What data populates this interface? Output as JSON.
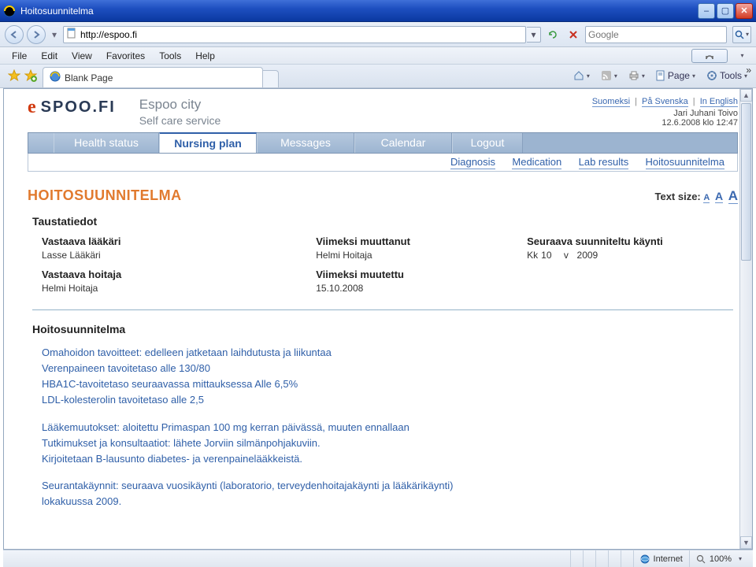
{
  "window": {
    "title": "Hoitosuunnitelma"
  },
  "address_bar": {
    "url": "http://espoo.fi"
  },
  "search": {
    "placeholder": "Google"
  },
  "menus": {
    "file": "File",
    "edit": "Edit",
    "view": "View",
    "favorites": "Favorites",
    "tools": "Tools",
    "help": "Help"
  },
  "tab": {
    "label": "Blank Page"
  },
  "cmdbar": {
    "page": "Page",
    "tools": "Tools"
  },
  "statusbar": {
    "zone": "Internet",
    "zoom": "100%"
  },
  "header": {
    "brand_e": "e",
    "brand_rest": "SPOO.FI",
    "slogan1": "Espoo city",
    "slogan2": "Self care service",
    "lang_fi": "Suomeksi",
    "lang_sv": "På Svenska",
    "lang_en": "In English",
    "user": "Jari Juhani Toivo",
    "datetime": "12.6.2008 klo 12:47"
  },
  "maintabs": {
    "health": "Health status",
    "nursing": "Nursing plan",
    "messages": "Messages",
    "calendar": "Calendar",
    "logout": "Logout"
  },
  "subnav": {
    "diagnosis": "Diagnosis",
    "medication": "Medication",
    "lab": "Lab results",
    "plan": "Hoitosuunnitelma"
  },
  "page_title": "HOITOSUUNNITELMA",
  "textsize_label": "Text size:",
  "section_bg": "Taustatiedot",
  "meta": {
    "doctor_lb": "Vastaava lääkäri",
    "doctor_vl": "Lasse Lääkäri",
    "nurse_lb": "Vastaava hoitaja",
    "nurse_vl": "Helmi Hoitaja",
    "modby_lb": "Viimeksi muuttanut",
    "modby_vl": "Helmi Hoitaja",
    "modon_lb": "Viimeksi muutettu",
    "modon_vl": "15.10.2008",
    "next_lb": "Seuraava suunniteltu käynti",
    "kk_label": "Kk",
    "kk_val": "10",
    "v_label": "v",
    "v_val": "2009"
  },
  "plan_title": "Hoitosuunnitelma",
  "plan_p1_l1": "Omahoidon tavoitteet: edelleen jatketaan laihdutusta ja liikuntaa",
  "plan_p1_l2": "Verenpaineen tavoitetaso alle 130/80",
  "plan_p1_l3": "HBA1C-tavoitetaso seuraavassa mittauksessa  Alle 6,5%",
  "plan_p1_l4": "LDL-kolesterolin tavoitetaso alle 2,5",
  "plan_p2_l1": "Lääkemuutokset: aloitettu Primaspan 100 mg kerran päivässä, muuten ennallaan",
  "plan_p2_l2": "Tutkimukset ja konsultaatiot: lähete Jorviin silmänpohjakuviin.",
  "plan_p2_l3": "Kirjoitetaan B-lausunto diabetes- ja verenpainelääkkeistä.",
  "plan_p3_l1": "Seurantakäynnit: seuraava vuosikäynti (laboratorio, terveydenhoitajakäynti ja lääkärikäynti)",
  "plan_p3_l2": "lokakuussa 2009."
}
